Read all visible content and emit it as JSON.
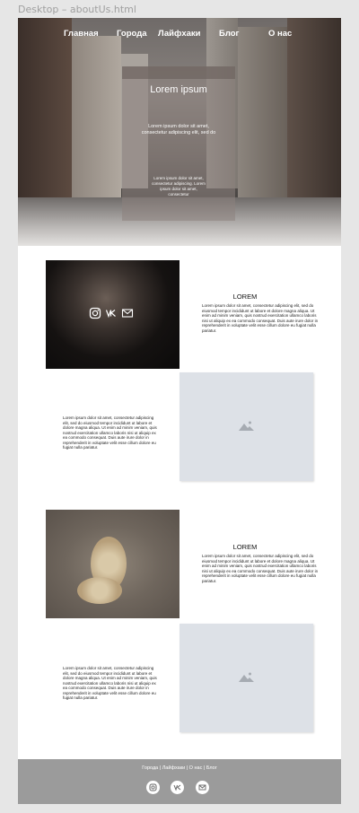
{
  "window": {
    "title": "Desktop – aboutUs.html"
  },
  "nav": {
    "items": [
      {
        "label": "Главная"
      },
      {
        "label": "Города"
      },
      {
        "label": "Лайфхаки"
      },
      {
        "label": "Блог"
      },
      {
        "label": "О нас"
      }
    ]
  },
  "hero": {
    "title": "Lorem ipsum",
    "text": "Lorem ipsum dolor sit amet, consectetur adipiscing elit, sed do",
    "small_text": "Lorem ipsum dolor sit amet, consectetur adipiscing. Lorem ipsum dolor sit amet, consectetur"
  },
  "sections": [
    {
      "title": "LOREM",
      "text": "Lorem ipsum dolor sit amet, consectetur adipiscing elit, sed do eiusmod tempor incididunt ut labore et dolore magna aliqua. Ut enim ad minim veniam, quis nostrud exercitation ullamco laboris nisi ut aliquip ex ea commodo consequat. Duis aute irure dolor in reprehenderit in voluptate velit esse cillum dolore eu fugiat nulla pariatur."
    },
    {
      "text": "Lorem ipsum dolor sit amet, consectetur adipiscing elit, sed do eiusmod tempor incididunt ut labore et dolore magna aliqua. Ut enim ad minim veniam, quis nostrud exercitation ullamco laboris nisi ut aliquip ex ea commodo consequat. Duis aute irure dolor in reprehenderit in voluptate velit esse cillum dolore eu fugiat nulla pariatur."
    },
    {
      "title": "LOREM",
      "text": "Lorem ipsum dolor sit amet, consectetur adipiscing elit, sed do eiusmod tempor incididunt ut labore et dolore magna aliqua. Ut enim ad minim veniam, quis nostrud exercitation ullamco laboris nisi ut aliquip ex ea commodo consequat. Duis aute irure dolor in reprehenderit in voluptate velit esse cillum dolore eu fugiat nulla pariatur."
    },
    {
      "text": "Lorem ipsum dolor sit amet, consectetur adipiscing elit, sed do eiusmod tempor incididunt ut labore et dolore magna aliqua. Ut enim ad minim veniam, quis nostrud exercitation ullamco laboris nisi ut aliquip ex ea commodo consequat. Duis aute irure dolor in reprehenderit in voluptate velit esse cillum dolore eu fugiat nulla pariatur."
    }
  ],
  "social_icons": [
    "instagram-icon",
    "vk-icon",
    "mail-icon"
  ],
  "footer": {
    "links": "Города | Лайфхаки | О нас | Блог",
    "icons": [
      "instagram-icon",
      "vk-icon",
      "mail-icon"
    ]
  },
  "colors": {
    "footer_bg": "#9b9b9b",
    "placeholder_bg": "#dde1e7",
    "artboard_bg": "#ffffff",
    "desktop_bg": "#e6e6e6"
  }
}
